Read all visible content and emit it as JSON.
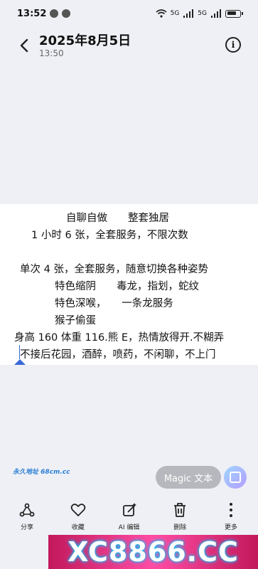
{
  "status": {
    "time": "13:52",
    "network_a": "5G",
    "network_b": "5G"
  },
  "header": {
    "title": "2025年8月5日",
    "subtitle": "13:50"
  },
  "photo_text": [
    "自聊自做　　整套独居",
    "1 小时 6 张，全套服务，不限次数",
    "单次 4 张，全套服务，随意切换各种姿势",
    "特色缩阴　　毒龙，指划，蛇纹",
    "特色深喉，　　一条龙服务",
    "猴子偷蛋",
    "身高 160 体重 116.熊 E，热情放得开.不糊弄",
    "不接后花园，酒醉，喷药，不闲聊，不上门"
  ],
  "watermark": "永久地址 68cm.cc",
  "magic_button": "Magic 文本",
  "toolbar": [
    {
      "label": "分享",
      "icon": "share-icon"
    },
    {
      "label": "收藏",
      "icon": "heart-icon"
    },
    {
      "label": "AI 编辑",
      "icon": "ai-edit-icon"
    },
    {
      "label": "删除",
      "icon": "trash-icon"
    },
    {
      "label": "更多",
      "icon": "more-icon"
    }
  ],
  "banner": "XC8866.CC"
}
